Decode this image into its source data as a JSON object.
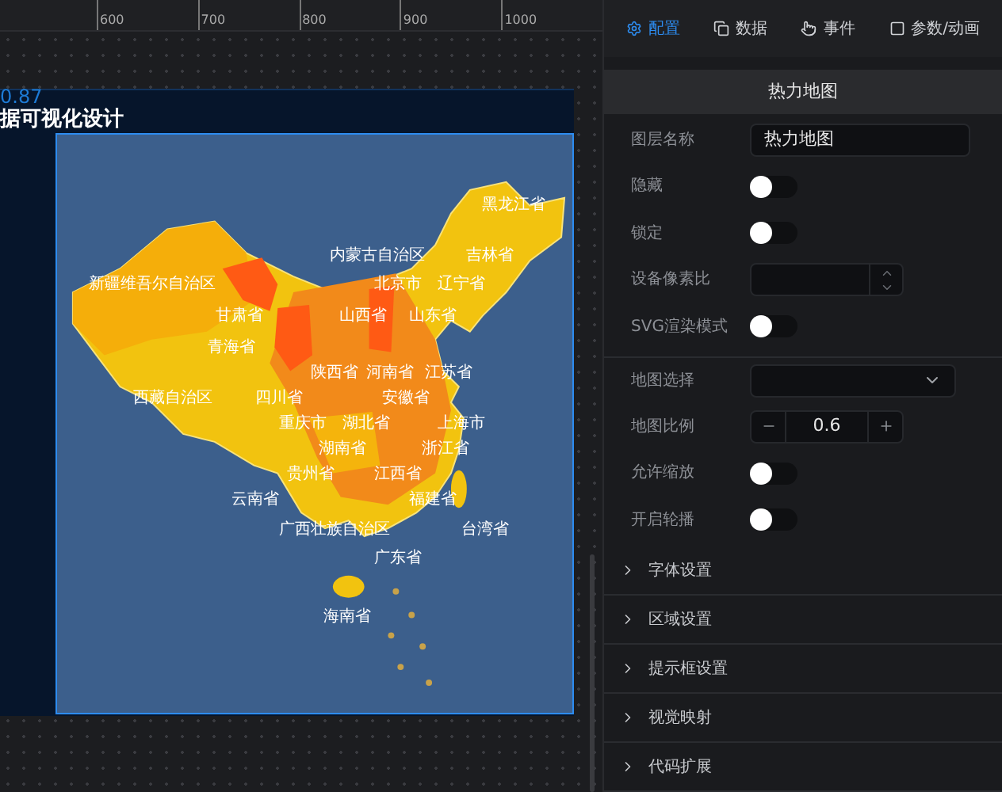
{
  "ruler": {
    "ticks": [
      "600",
      "700",
      "800",
      "900",
      "1000"
    ]
  },
  "canvas": {
    "coordinate": "0.87",
    "screen_title": "据可视化设计",
    "map_labels": [
      "黑龙江省",
      "内蒙古自治区",
      "吉林省",
      "新疆维吾尔自治区",
      "北京市",
      "辽宁省",
      "甘肃省",
      "山西省",
      "山东省",
      "青海省",
      "陕西省",
      "河南省",
      "江苏省",
      "西藏自治区",
      "四川省",
      "安徽省",
      "重庆市",
      "湖北省",
      "上海市",
      "湖南省",
      "浙江省",
      "贵州省",
      "江西省",
      "云南省",
      "福建省",
      "广西壮族自治区",
      "台湾省",
      "广东省",
      "海南省"
    ]
  },
  "panel": {
    "tabs": [
      {
        "label": "配置",
        "selected": true
      },
      {
        "label": "数据",
        "selected": false
      },
      {
        "label": "事件",
        "selected": false
      },
      {
        "label": "参数/动画",
        "selected": false
      }
    ],
    "header": "热力地图",
    "fields": [
      {
        "kind": "text",
        "label": "图层名称",
        "value": "热力地图"
      },
      {
        "kind": "switch",
        "label": "隐藏",
        "on": false
      },
      {
        "kind": "switch",
        "label": "锁定",
        "on": false
      },
      {
        "kind": "number",
        "label": "设备像素比"
      },
      {
        "kind": "switch",
        "label": "SVG渲染模式",
        "on": false
      },
      {
        "kind": "select",
        "label": "地图选择"
      },
      {
        "kind": "stepper",
        "label": "地图比例",
        "value": "0.6"
      },
      {
        "kind": "switch",
        "label": "允许缩放",
        "on": false
      },
      {
        "kind": "switch",
        "label": "开启轮播",
        "on": false
      }
    ],
    "sections": [
      {
        "label": "字体设置",
        "expanded": false
      },
      {
        "label": "区域设置",
        "expanded": false
      },
      {
        "label": "提示框设置",
        "expanded": false
      },
      {
        "label": "视觉映射",
        "expanded": false
      },
      {
        "label": "代码扩展",
        "expanded": false
      }
    ]
  }
}
